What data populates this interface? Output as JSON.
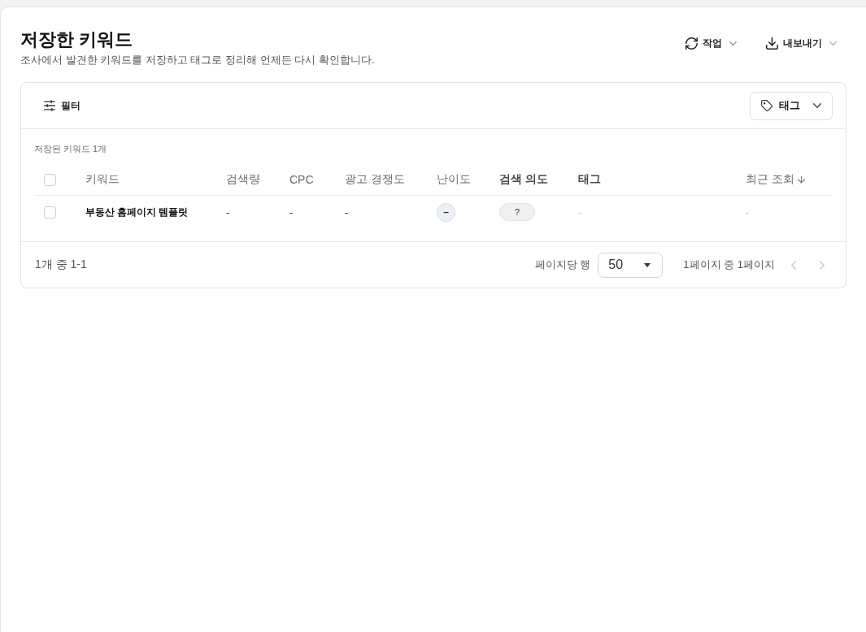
{
  "page": {
    "title": "저장한 키워드",
    "subtitle": "조사에서 발견한 키워드를 저장하고 태그로 정리해 언제든 다시 확인합니다."
  },
  "header_actions": [
    {
      "label": "작업"
    },
    {
      "label": "내보내기"
    }
  ],
  "toolbar": {
    "filter_button": "필터",
    "tag_button": "태그"
  },
  "table": {
    "caption": "저장된 키워드 1개",
    "select_all": {
      "checked": false
    },
    "columns": [
      {
        "label": "키워드",
        "emphasized": false,
        "sorted": false
      },
      {
        "label": "검색량",
        "emphasized": false,
        "sorted": false
      },
      {
        "label": "CPC",
        "emphasized": false,
        "sorted": false
      },
      {
        "label": "광고 경쟁도",
        "emphasized": false,
        "sorted": false
      },
      {
        "label": "난이도",
        "emphasized": false,
        "sorted": false
      },
      {
        "label": "검색 의도",
        "emphasized": true,
        "sorted": false
      },
      {
        "label": "태그",
        "emphasized": true,
        "sorted": false
      },
      {
        "label": "최근 조회",
        "emphasized": false,
        "sorted": true
      }
    ],
    "rows": [
      {
        "checked": false,
        "keyword": "부동산 홈페이지 템플릿",
        "search_volume": "-",
        "cpc": "-",
        "competition": "-",
        "difficulty": "–",
        "intent": "?",
        "tags": "-",
        "last_viewed": "-"
      }
    ]
  },
  "pagination": {
    "range": "1개 중 1-1",
    "rows_per_page_label": "페이지당 행",
    "rows_per_page": "50",
    "page_info": "1페이지 중 1페이지",
    "previous": {
      "disabled": true
    },
    "next": {
      "disabled": true
    }
  }
}
